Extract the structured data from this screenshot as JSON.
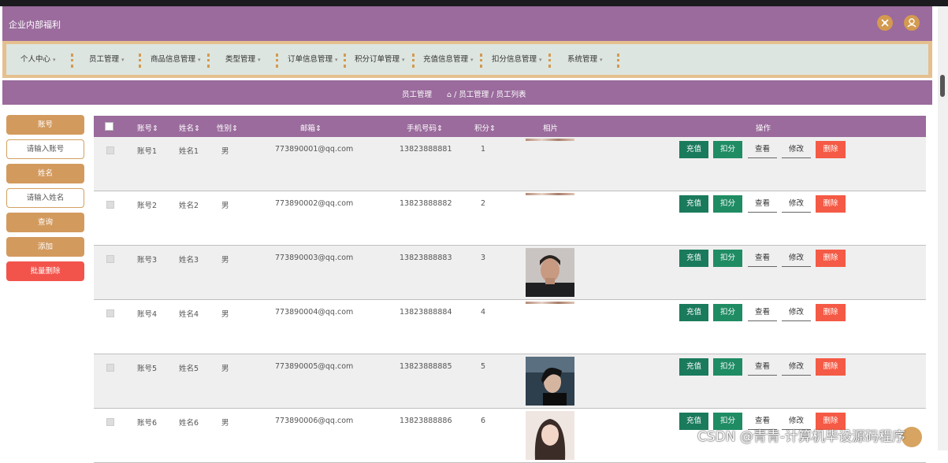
{
  "app": {
    "title": "企业内部福利"
  },
  "header_icons": [
    "fullscreen-icon",
    "user-icon"
  ],
  "menu": [
    {
      "label": "个人中心"
    },
    {
      "label": "员工管理"
    },
    {
      "label": "商品信息管理"
    },
    {
      "label": "类型管理"
    },
    {
      "label": "订单信息管理"
    },
    {
      "label": "积分订单管理"
    },
    {
      "label": "充值信息管理"
    },
    {
      "label": "扣分信息管理"
    },
    {
      "label": "系统管理"
    }
  ],
  "breadcrumb": {
    "section": "员工管理",
    "path": "/ 员工管理 / 员工列表"
  },
  "sidebar": {
    "account_label": "账号",
    "account_placeholder": "请输入账号",
    "name_label": "姓名",
    "name_placeholder": "请输入姓名",
    "query": "查询",
    "add": "添加",
    "batch_delete": "批量删除"
  },
  "table": {
    "columns": [
      "账号",
      "姓名",
      "性别",
      "邮箱",
      "手机号码",
      "积分",
      "相片",
      "操作"
    ],
    "rows": [
      {
        "account": "账号1",
        "name": "姓名1",
        "gender": "男",
        "email": "773890001@qq.com",
        "phone": "13823888881",
        "points": "1"
      },
      {
        "account": "账号2",
        "name": "姓名2",
        "gender": "男",
        "email": "773890002@qq.com",
        "phone": "13823888882",
        "points": "2"
      },
      {
        "account": "账号3",
        "name": "姓名3",
        "gender": "男",
        "email": "773890003@qq.com",
        "phone": "13823888883",
        "points": "3"
      },
      {
        "account": "账号4",
        "name": "姓名4",
        "gender": "男",
        "email": "773890004@qq.com",
        "phone": "13823888884",
        "points": "4"
      },
      {
        "account": "账号5",
        "name": "姓名5",
        "gender": "男",
        "email": "773890005@qq.com",
        "phone": "13823888885",
        "points": "5"
      },
      {
        "account": "账号6",
        "name": "姓名6",
        "gender": "男",
        "email": "773890006@qq.com",
        "phone": "13823888886",
        "points": "6"
      }
    ],
    "actions": {
      "recharge": "充值",
      "deduct": "扣分",
      "view": "查看",
      "edit": "修改",
      "delete": "删除"
    }
  },
  "watermark": "CSDN @青青-计算机毕设源码程序",
  "colors": {
    "header": "#9a6b9c",
    "accent": "#d39a5e",
    "danger": "#f2544c",
    "action_green": "#1a7a5c"
  }
}
